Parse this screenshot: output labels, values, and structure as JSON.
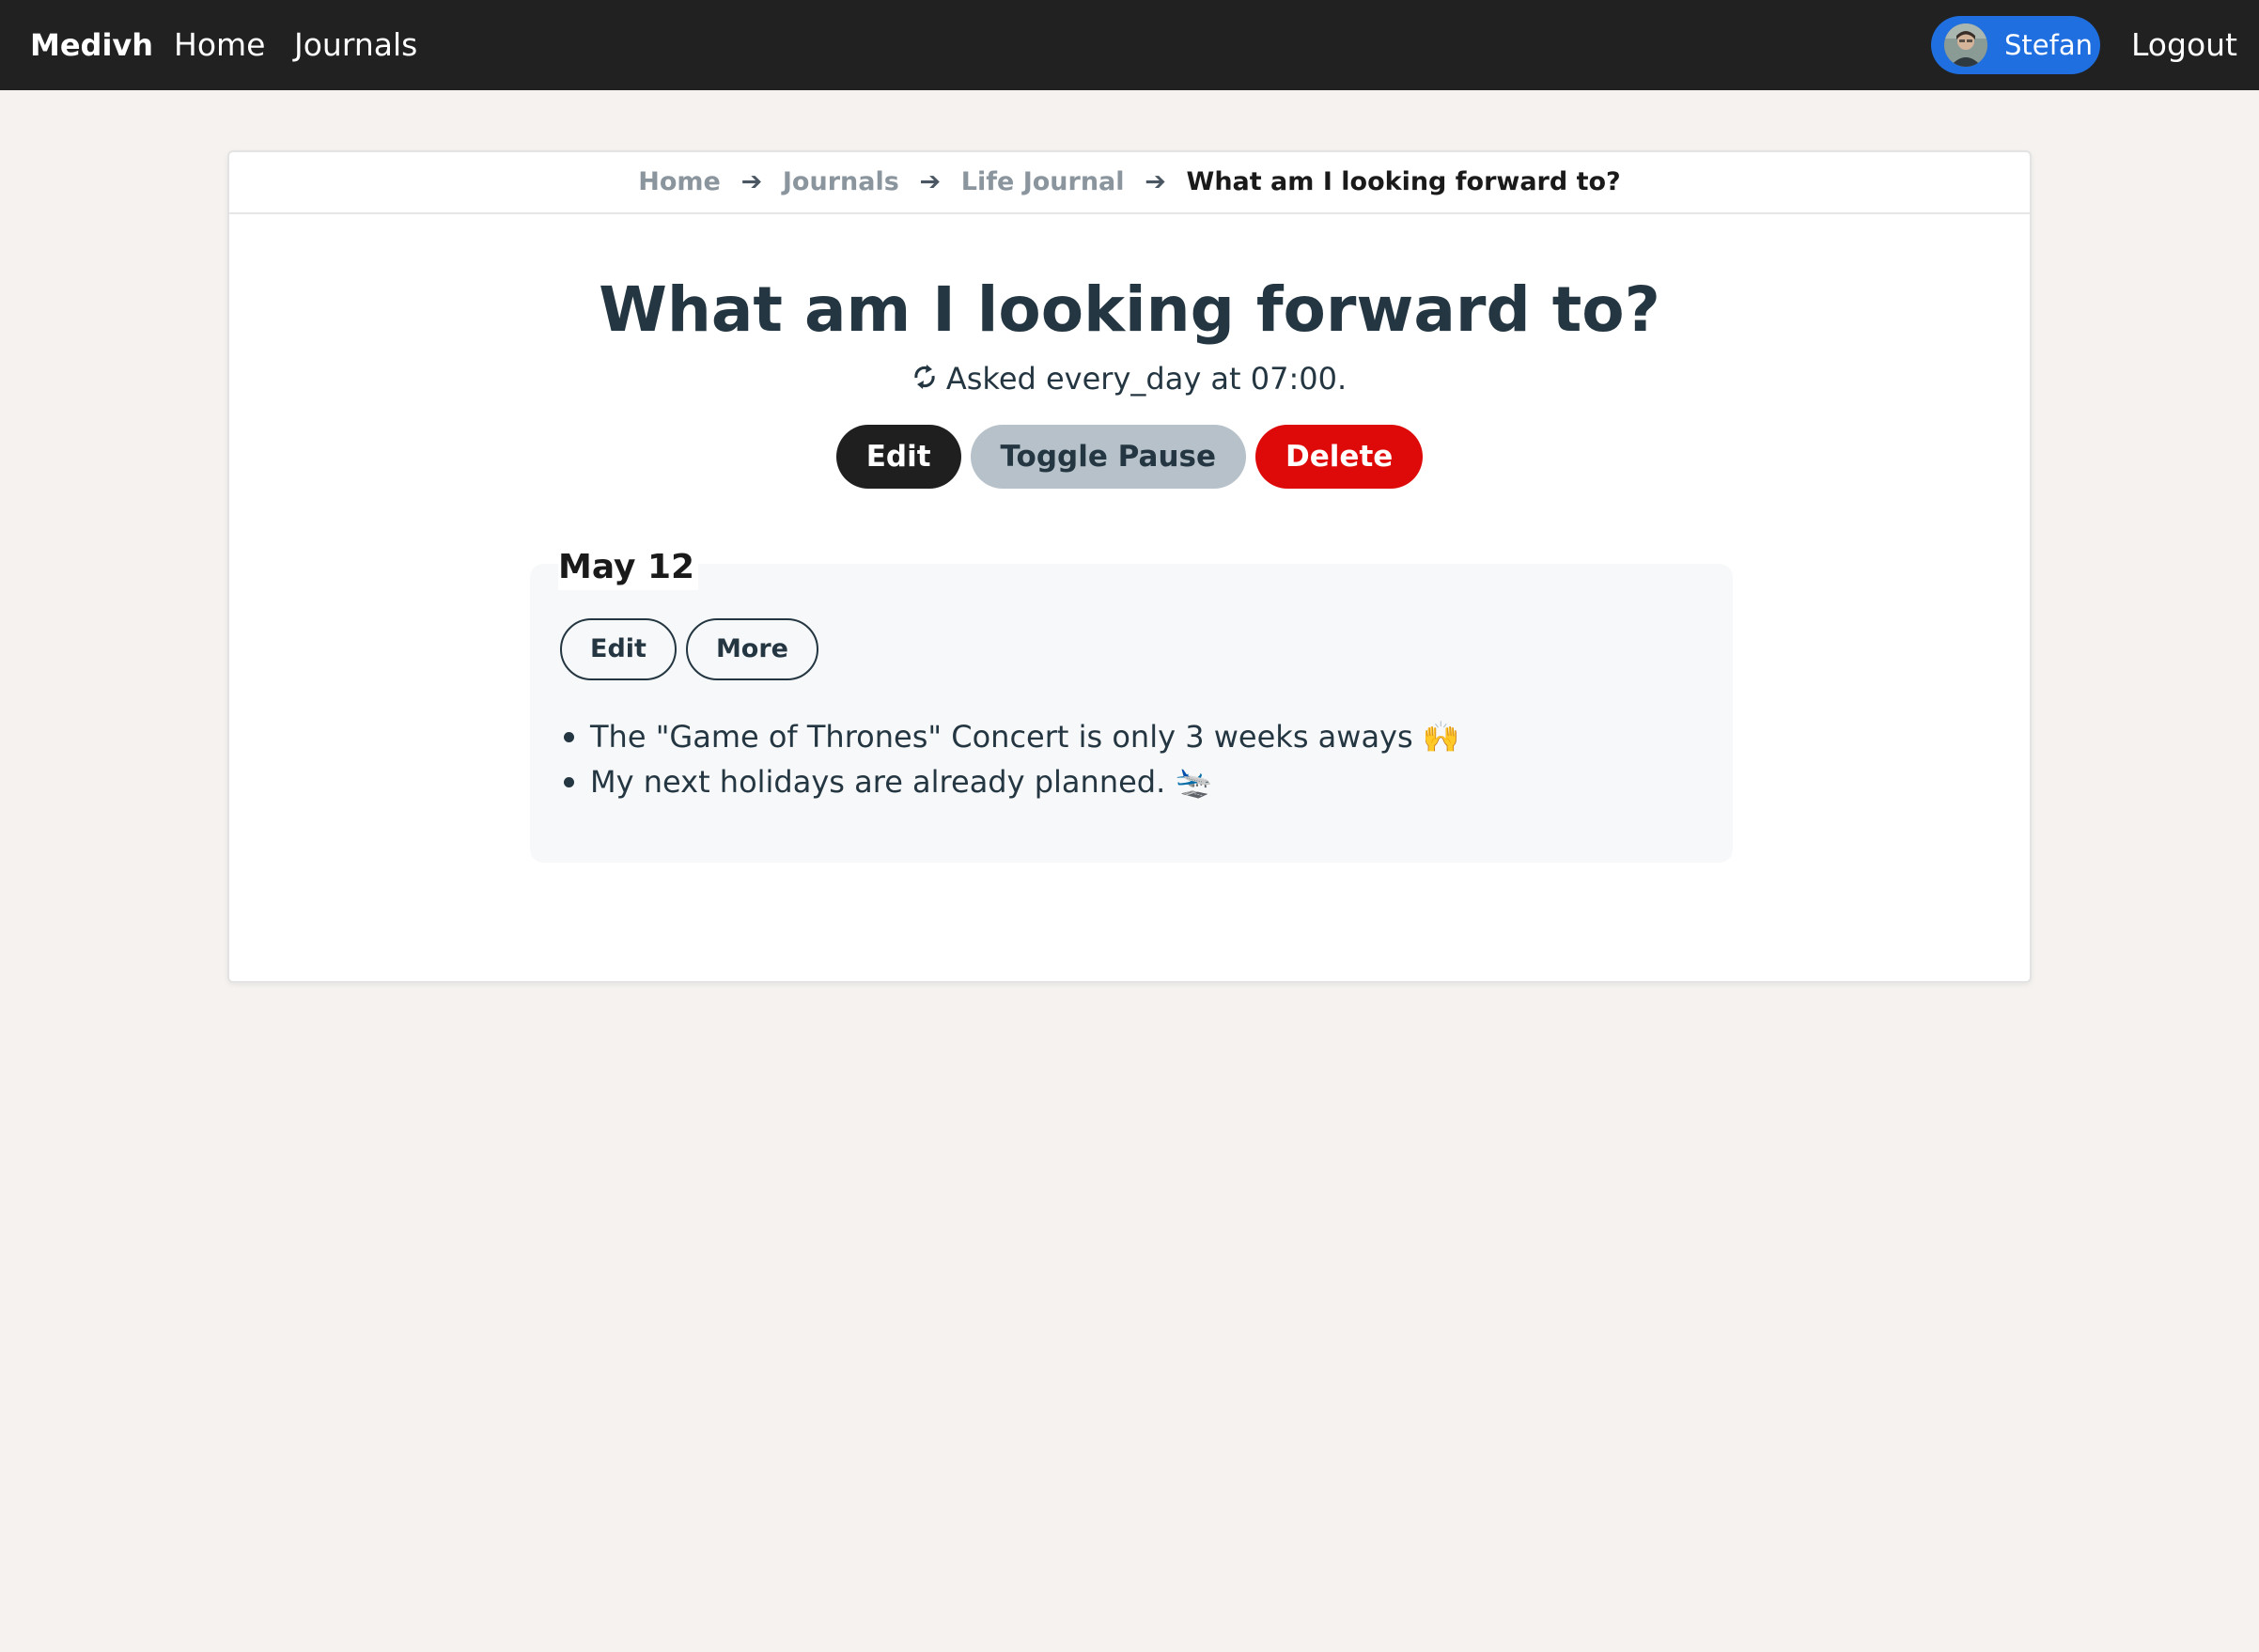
{
  "navbar": {
    "brand": "Medivh",
    "links": [
      "Home",
      "Journals"
    ],
    "user": {
      "name": "Stefan",
      "avatar_icon": "avatar-photo"
    },
    "logout": "Logout",
    "background": "#212121",
    "user_pill_color": "#1f6fe0"
  },
  "breadcrumb": {
    "items": [
      "Home",
      "Journals",
      "Life Journal",
      "What am I looking forward to?"
    ],
    "separator": "➔"
  },
  "question": {
    "title": "What am I looking forward to?",
    "schedule_icon": "repeat-icon",
    "schedule_text": "Asked every_day at 07:00.",
    "actions": {
      "edit": "Edit",
      "toggle_pause": "Toggle Pause",
      "delete": "Delete"
    },
    "colors": {
      "edit": "#1f1f1f",
      "toggle_pause": "#b7c1c9",
      "delete": "#de0a0a"
    }
  },
  "entry": {
    "date": "May 12",
    "actions": {
      "edit": "Edit",
      "more": "More"
    },
    "bullets": [
      "The \"Game of Thrones\" Concert is only 3 weeks aways 🙌",
      "My next holidays are already planned. 🛬"
    ]
  }
}
